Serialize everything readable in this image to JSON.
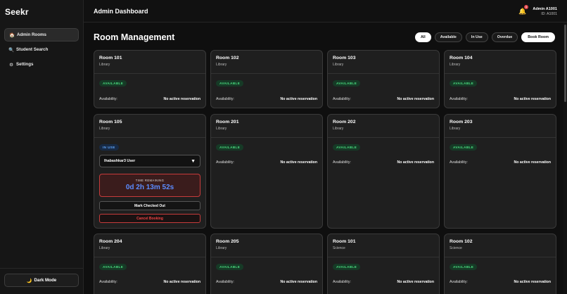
{
  "app": {
    "brand": "Seekr"
  },
  "sidebar": {
    "items": [
      {
        "label": "Admin Rooms",
        "icon": "🏠"
      },
      {
        "label": "Student Search",
        "icon": "🔍"
      },
      {
        "label": "Settings",
        "icon": "⚙"
      }
    ],
    "dark_mode": {
      "icon": "🌙",
      "label": "Dark Mode"
    }
  },
  "header": {
    "title": "Admin Dashboard",
    "notifications": "1",
    "admin_name": "Admin A1001",
    "admin_id": "ID: A1001"
  },
  "main": {
    "title": "Room Management",
    "filters": [
      "All",
      "Available",
      "In Use",
      "Overdue"
    ],
    "book_button": "Book Room"
  },
  "labels": {
    "availability": "Availability:",
    "no_reservation": "No active reservation",
    "available": "AVAILABLE",
    "in_use": "IN USE"
  },
  "rooms": [
    {
      "name": "Room 101",
      "location": "Library"
    },
    {
      "name": "Room 102",
      "location": "Library"
    },
    {
      "name": "Room 103",
      "location": "Library"
    },
    {
      "name": "Room 104",
      "location": "Library"
    },
    {
      "name": "Room 105",
      "location": "Library"
    },
    {
      "name": "Room 201",
      "location": "Library"
    },
    {
      "name": "Room 202",
      "location": "Library"
    },
    {
      "name": "Room 203",
      "location": "Library"
    },
    {
      "name": "Room 204",
      "location": "Library"
    },
    {
      "name": "Room 205",
      "location": "Library"
    },
    {
      "name": "Room 101",
      "location": "Science"
    },
    {
      "name": "Room 102",
      "location": "Science"
    }
  ],
  "in_use": {
    "user": "lhabashkar3 User",
    "time_label": "TIME REMAINING",
    "time_value": "0d 2h 13m 52s",
    "checkout_label": "Mark Checked Out",
    "cancel_label": "Cancel Booking"
  }
}
